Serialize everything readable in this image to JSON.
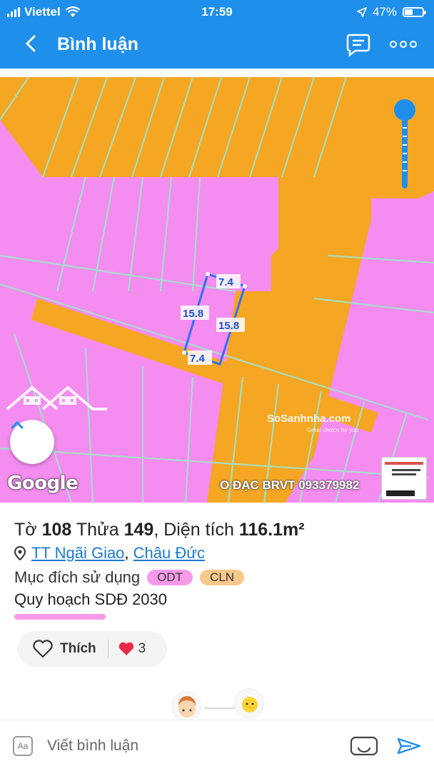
{
  "status_bar": {
    "carrier": "Viettel",
    "time": "17:59",
    "battery": "47%"
  },
  "header": {
    "title": "Bình luận",
    "back_icon": "chevron-left-icon",
    "chat_icon": "chat-bubble-icon",
    "more_icon": "more-options-icon"
  },
  "map": {
    "labels": {
      "top": "7.4",
      "left": "15.8",
      "right": "15.8",
      "bottom": "7.4"
    },
    "google_logo": "Google",
    "watermark": "O ĐẠC BRVT 093379982",
    "brand_name": "SoSanhnha.com",
    "brand_tagline": "Great choice for you",
    "colors": {
      "residential": "#f58cf0",
      "road": "#f5a623"
    }
  },
  "info": {
    "line1_a": "Tờ",
    "sheet": "108",
    "line1_b": "Thửa",
    "parcel": "149",
    "line1_c": ", Diện tích",
    "area": "116.1m²",
    "location_town": "TT Ngãi Giao",
    "location_sep": ",",
    "location_district": "Châu Đức",
    "usage_label": "Mục đích sử dụng",
    "tags": [
      "ODT",
      "CLN"
    ],
    "plan_label": "Quy hoạch SDĐ 2030"
  },
  "reactions": {
    "like_label": "Thích",
    "heart_count": "3"
  },
  "comment": {
    "placeholder": "Viết bình luận"
  }
}
